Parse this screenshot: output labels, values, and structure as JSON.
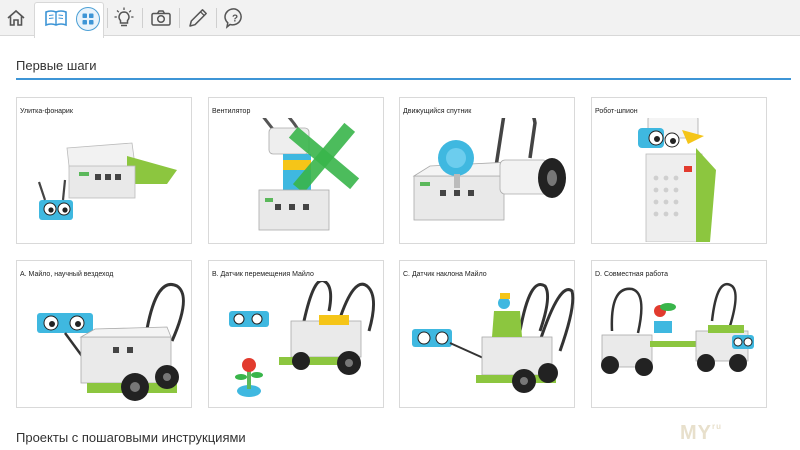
{
  "section": {
    "title": "Первые шаги",
    "next_title": "Проекты с пошаговыми инструкциями"
  },
  "toolbar": {
    "icons": [
      "home-icon",
      "book-icon",
      "grid-icon",
      "lightbulb-icon",
      "camera-icon",
      "pencil-icon",
      "help-icon"
    ]
  },
  "cards": [
    {
      "label": "Улитка-фонарик"
    },
    {
      "label": "Вентилятор"
    },
    {
      "label": "Движущийся спутник"
    },
    {
      "label": "Робот-шпион"
    },
    {
      "label": "A. Майло, научный вездеход"
    },
    {
      "label": "B. Датчик перемещения Майло"
    },
    {
      "label": "C. Датчик наклона Майло"
    },
    {
      "label": "D. Совместная работа"
    }
  ],
  "watermark": {
    "text": "MY",
    "suffix": "ru"
  },
  "colors": {
    "accent": "#3d95d6",
    "lego_green": "#8cc63f",
    "lego_azure": "#3fb8e0"
  }
}
